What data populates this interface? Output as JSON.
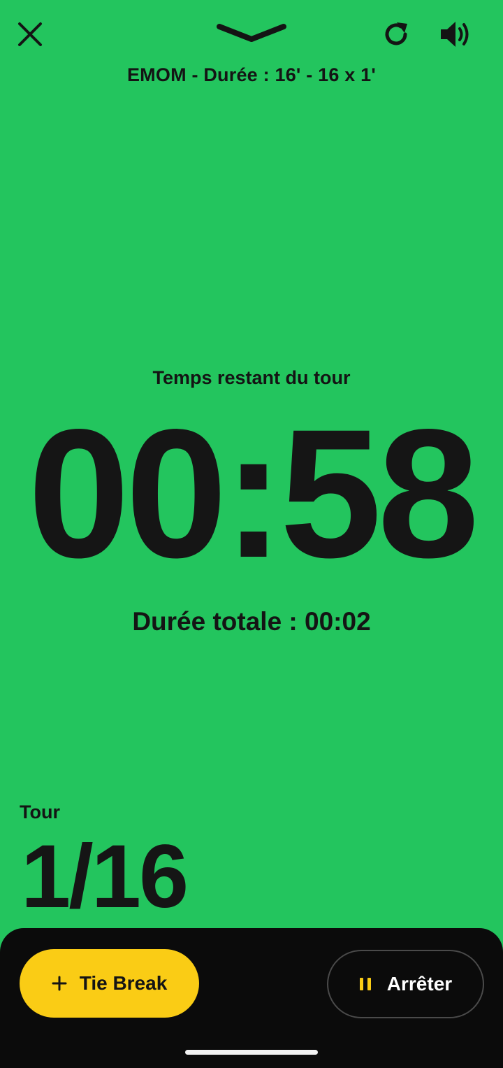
{
  "header": {
    "subtitle": "EMOM - Durée : 16' - 16 x 1'",
    "icons": [
      "close-icon",
      "chevron-down-icon",
      "refresh-icon",
      "volume-icon"
    ]
  },
  "timer": {
    "round_label": "Temps restant du tour",
    "value": "00:58",
    "total": "Durée totale : 00:02"
  },
  "round": {
    "label": "Tour",
    "value": "1/16"
  },
  "actions": {
    "tiebreak_label": "Tie Break",
    "stop_label": "Arrêter"
  },
  "colors": {
    "background": "#23c55e",
    "accent": "#facc15",
    "panel": "#0b0b0b",
    "text": "#141414"
  }
}
